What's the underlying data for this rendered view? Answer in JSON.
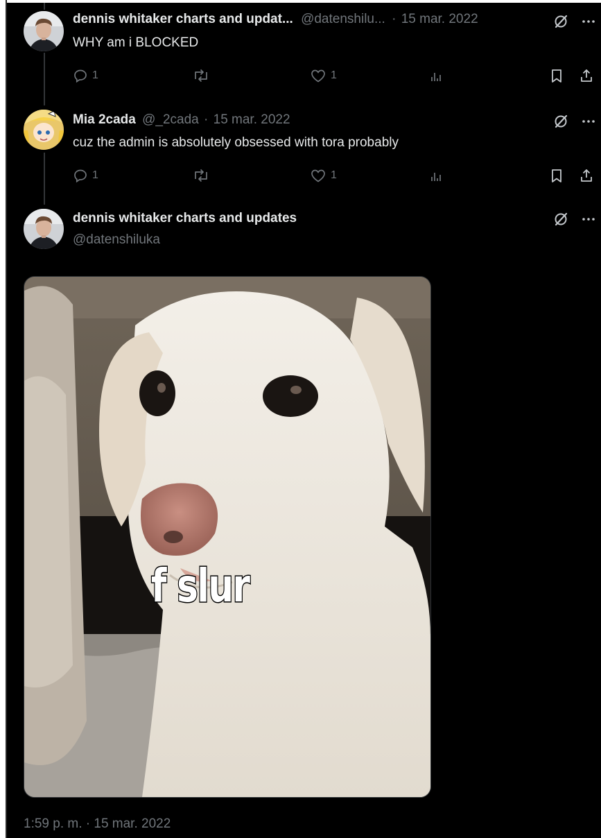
{
  "colors": {
    "background": "#000000",
    "text": "#e7e9ea",
    "muted": "#71767b",
    "divider": "#333639"
  },
  "tweets": [
    {
      "name": "dennis whitaker charts and updat...",
      "handle": "@datenshilu...",
      "separator": "·",
      "date": "15 mar. 2022",
      "text": "WHY am i BLOCKED",
      "reply_count": "1",
      "like_count": "1",
      "icons": [
        "reply-icon",
        "retweet-icon",
        "like-icon",
        "views-icon",
        "bookmark-icon",
        "share-icon",
        "grok-icon",
        "more-icon"
      ]
    },
    {
      "name": "Mia 2cada",
      "handle": "@_2cada",
      "separator": "·",
      "date": "15 mar. 2022",
      "text": "cuz the admin is absolutely obsessed with tora probably",
      "reply_count": "1",
      "like_count": "1",
      "icons": [
        "reply-icon",
        "retweet-icon",
        "like-icon",
        "views-icon",
        "bookmark-icon",
        "share-icon",
        "grok-icon",
        "more-icon"
      ]
    }
  ],
  "main_tweet": {
    "name": "dennis whitaker charts and updates",
    "handle": "@datenshiluka",
    "meme_caption": "f slur",
    "timestamp": "1:59 p. m. · 15 mar. 2022"
  }
}
